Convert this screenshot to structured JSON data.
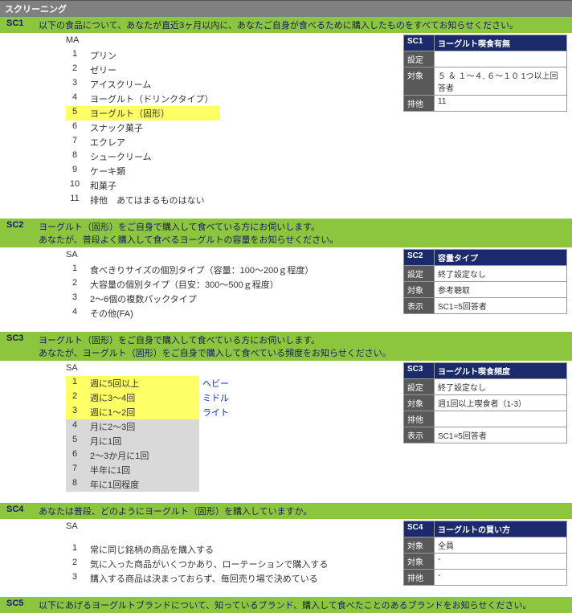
{
  "sectionTitle": "スクリーニング",
  "questions": [
    {
      "code": "SC1",
      "lines": [
        "以下の食品について、あなたが直近3ヶ月以内に、あなたご自身が食べるために購入したものをすべてお知らせください。"
      ],
      "qtype": "MA",
      "options": [
        {
          "num": "1",
          "label": "プリン"
        },
        {
          "num": "2",
          "label": "ゼリー"
        },
        {
          "num": "3",
          "label": "アイスクリーム"
        },
        {
          "num": "4",
          "label": "ヨーグルト（ドリンクタイプ）"
        },
        {
          "num": "5",
          "label": "ヨーグルト（固形）",
          "hl": "yellow"
        },
        {
          "num": "6",
          "label": "スナック菓子"
        },
        {
          "num": "7",
          "label": "エクレア"
        },
        {
          "num": "8",
          "label": "シュークリーム"
        },
        {
          "num": "9",
          "label": "ケーキ類"
        },
        {
          "num": "10",
          "label": "和菓子"
        },
        {
          "num": "11",
          "pre": "排他",
          "label": "あてはまるものはない"
        }
      ],
      "meta": {
        "code": "SC1",
        "title": "ヨーグルト喫食有無",
        "rows": [
          {
            "k": "設定",
            "v": ""
          },
          {
            "k": "対象",
            "v": "５ ＆ １〜４, ６〜１０ 1つ以上回答者"
          },
          {
            "k": "排他",
            "v": "11"
          }
        ]
      }
    },
    {
      "code": "SC2",
      "lines": [
        "ヨーグルト（固形）をご自身で購入して食べている方にお伺いします。",
        "あなたが、普段よく購入して食べるヨーグルトの容量をお知らせください。"
      ],
      "qtype": "SA",
      "options": [
        {
          "num": "1",
          "label": "食べきりサイズの個別タイプ（容量：100〜200ｇ程度）"
        },
        {
          "num": "2",
          "label": "大容量の個別タイプ（目安：300〜500ｇ程度）"
        },
        {
          "num": "3",
          "label": "2〜6個の複数パックタイプ"
        },
        {
          "num": "4",
          "label": "その他(FA)"
        }
      ],
      "meta": {
        "code": "SC2",
        "title": "容量タイプ",
        "rows": [
          {
            "k": "設定",
            "v": "終了設定なし"
          },
          {
            "k": "対象",
            "v": "参考聴取"
          },
          {
            "k": "表示",
            "v": "SC1=5回答者"
          }
        ]
      }
    },
    {
      "code": "SC3",
      "lines": [
        "ヨーグルト（固形）をご自身で購入して食べている方にお伺いします。",
        "あなたが、ヨーグルト（固形）をご自身で購入して食べている頻度をお知らせください。"
      ],
      "qtype": "SA",
      "options": [
        {
          "num": "1",
          "label": "週に5回以上",
          "note": "ヘビー",
          "hl": "yellow"
        },
        {
          "num": "2",
          "label": "週に3〜4回",
          "note": "ミドル",
          "hl": "yellow"
        },
        {
          "num": "3",
          "label": "週に1〜2回",
          "note": "ライト",
          "hl": "yellow"
        },
        {
          "num": "4",
          "label": "月に2〜3回",
          "hl": "gray"
        },
        {
          "num": "5",
          "label": "月に1回",
          "hl": "gray"
        },
        {
          "num": "6",
          "label": "2〜3か月に1回",
          "hl": "gray"
        },
        {
          "num": "7",
          "label": "半年に1回",
          "hl": "gray"
        },
        {
          "num": "8",
          "label": "年に1回程度",
          "hl": "gray"
        }
      ],
      "meta": {
        "code": "SC3",
        "title": "ヨーグルト喫食頻度",
        "rows": [
          {
            "k": "設定",
            "v": "終了設定なし"
          },
          {
            "k": "対象",
            "v": "週1回以上喫食者（1-3）"
          },
          {
            "k": "排他",
            "v": ""
          },
          {
            "k": "表示",
            "v": "SC1=5回答者"
          }
        ]
      }
    },
    {
      "code": "SC4",
      "lines": [
        "あなたは普段、どのようにヨーグルト（固形）を購入していますか。"
      ],
      "qtype": "SA",
      "preGap": true,
      "options": [
        {
          "num": "1",
          "label": "常に同じ銘柄の商品を購入する"
        },
        {
          "num": "2",
          "label": "気に入った商品がいくつかあり、ローテーションで購入する"
        },
        {
          "num": "3",
          "label": "購入する商品は決まっておらず、毎回売り場で決めている"
        }
      ],
      "meta": {
        "code": "SC4",
        "title": "ヨーグルトの買い方",
        "rows": [
          {
            "k": "対象",
            "v": "全員"
          },
          {
            "k": "対象",
            "v": "-"
          },
          {
            "k": "排他",
            "v": "-"
          }
        ]
      }
    },
    {
      "code": "SC5",
      "lines": [
        "以下にあげるヨーグルトブランドについて、知っているブランド、購入して食べたことのあるブランドをお知らせください。"
      ],
      "noBody": true
    }
  ]
}
